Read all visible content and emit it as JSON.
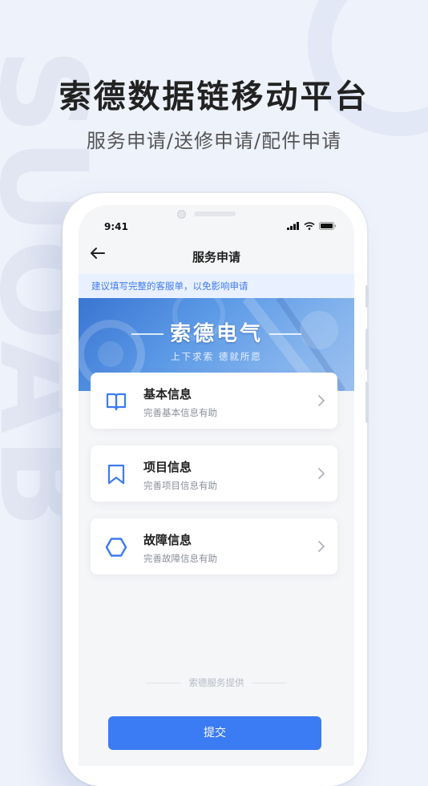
{
  "hero": {
    "title": "索德数据链移动平台",
    "subtitle": "服务申请/送修申请/配件申请",
    "background_letters": "SUOAB"
  },
  "status_bar": {
    "time": "9:41",
    "icons": [
      "signal-icon",
      "wifi-icon",
      "battery-icon"
    ]
  },
  "nav": {
    "back_icon": "arrow-left-icon",
    "title": "服务申请"
  },
  "notice": {
    "text": "建议填写完整的客服单，以免影响申请"
  },
  "banner": {
    "title": "索德电气",
    "subtitle": "上下求索  德就所愿"
  },
  "cards": [
    {
      "icon": "book-icon",
      "title": "基本信息",
      "desc": "完善基本信息有助"
    },
    {
      "icon": "bookmark-icon",
      "title": "项目信息",
      "desc": "完善项目信息有助"
    },
    {
      "icon": "hexagon-icon",
      "title": "故障信息",
      "desc": "完善故障信息有助"
    }
  ],
  "footer": {
    "note": "索德服务提供"
  },
  "submit": {
    "label": "提交"
  },
  "colors": {
    "accent": "#3b7bf3",
    "notice_bg": "#e9f0ff",
    "page_bg": "#eef2fb"
  }
}
